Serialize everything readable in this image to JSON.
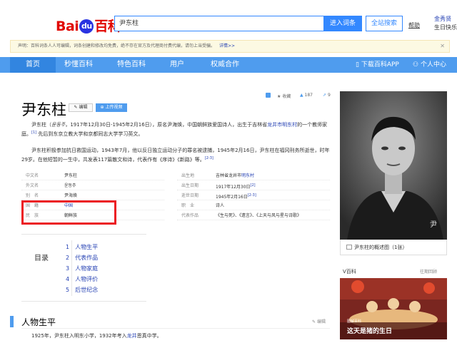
{
  "header": {
    "logo_bai": "Bai",
    "logo_du": "du",
    "logo_baike": "百科",
    "search_value": "尹东柱",
    "enter_button": "进入词条",
    "site_search_button": "全站搜索",
    "help": "帮助",
    "user_name": "金秀贤",
    "user_sub": "生日快乐"
  },
  "notice": {
    "text": "声明：百科词条人人可编辑，词条创建和修改均免费，绝不存在官方及代理商付费代编，请勿上当受骗。",
    "more": "详情>>",
    "close": "✕"
  },
  "nav": {
    "items": [
      "首页",
      "秒懂百科",
      "特色百科",
      "用户",
      "权威合作"
    ],
    "download": "下载百科APP",
    "personal": "个人中心"
  },
  "article": {
    "title": "尹东柱",
    "edit_button": "编辑",
    "video_button": "上传视频",
    "favorites_label": "收藏",
    "likes": "187",
    "shares": "9",
    "intro_1a": "尹东柱（",
    "intro_1b": "윤동주",
    "intro_1c": "，1917年12月30日-1945年2月16日），原名尹海焕，中国朝鲜族爱国诗人，出生于吉林省",
    "intro_1_link": "龙井市明东村",
    "intro_1d": "的一个教师家庭。",
    "intro_1_ref": "[1]",
    "intro_1e": "先后到东京立教大学和京都同志大学学习英文。",
    "intro_2": "尹东柱积极参加抗日救国运动，1943年7月，他以反日独立运动分子的罪名被逮捕，1945年2月16日，尹东柱在福冈刑务所逝世，时年29岁。在他短暂的一生中，共发表117篇散文和诗，代表作有《序诗》《新路》等。",
    "intro_2_ref": "[2-3]"
  },
  "infobox": {
    "left": [
      {
        "k": "中文名",
        "v": "尹东柱"
      },
      {
        "k": "外文名",
        "v": "윤동주"
      },
      {
        "k": "别　名",
        "v": "尹海焕"
      },
      {
        "k": "国　籍",
        "v": "中国"
      },
      {
        "k": "民　族",
        "v": "朝鲜族"
      }
    ],
    "right": [
      {
        "k": "出生地",
        "v": "吉林省龙井市",
        "link": "明东村"
      },
      {
        "k": "出生日期",
        "v": "1917年12月30日",
        "ref": "[2]"
      },
      {
        "k": "逝世日期",
        "v": "1945年2月16日",
        "ref": "[2-3]"
      },
      {
        "k": "职　业",
        "v": "诗人"
      },
      {
        "k": "代表作品",
        "v": "《生与死》、《遗言》、《上天与风与星与诗歌》"
      }
    ]
  },
  "toc": {
    "label": "目录",
    "items": [
      "1　人物生平",
      "2　代表作品",
      "3　人物家庭",
      "4　人物评价",
      "5　后世纪念"
    ]
  },
  "section": {
    "title": "人物生平",
    "edit": "编辑",
    "para": "1925年，尹东柱入明东小学，1932年考入",
    "para_link": "龙井",
    "para_end": "恩真中学。"
  },
  "sidebar": {
    "photo_caption": "尹东柱的概述图（1张）",
    "vbaike_label": "V百科",
    "vbaike_more": "往期回顾",
    "video_tag": "图解百科",
    "video_title": "这天是猪的生日"
  },
  "colors": {
    "brand_blue": "#4f9cee",
    "link": "#2440b3",
    "highlight_red": "#ec1c24"
  }
}
